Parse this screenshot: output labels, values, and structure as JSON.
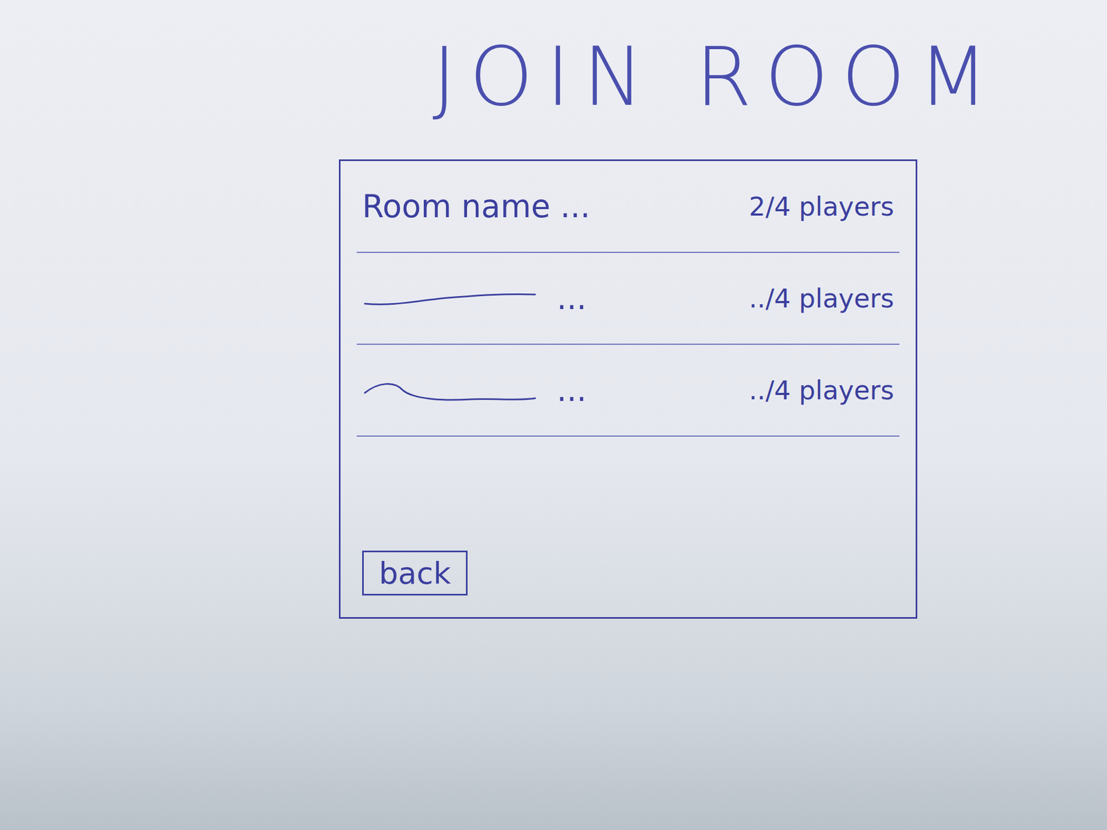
{
  "title": "JOIN ROOM",
  "rooms": [
    {
      "kind": "text",
      "label": "Room name ...",
      "players": "2/4 players"
    },
    {
      "kind": "squiggle",
      "label": "...",
      "players": "../4 players"
    },
    {
      "kind": "squiggle",
      "label": "...",
      "players": "../4 players"
    }
  ],
  "buttons": [
    "back"
  ]
}
